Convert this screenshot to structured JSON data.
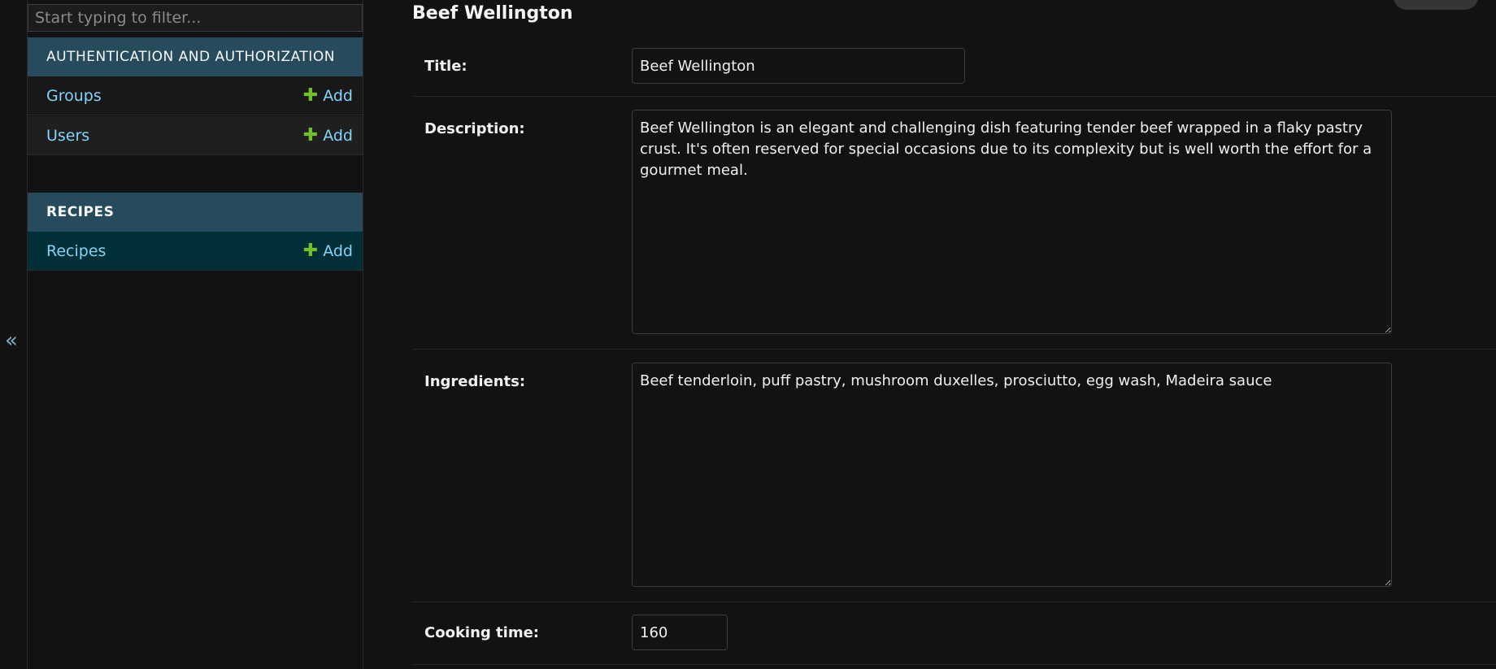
{
  "sidebar": {
    "toggle_label": "«",
    "filter_placeholder": "Start typing to filter...",
    "apps": [
      {
        "name": "AUTHENTICATION AND AUTHORIZATION",
        "models": [
          {
            "name": "Groups",
            "add_label": "Add"
          },
          {
            "name": "Users",
            "add_label": "Add"
          }
        ]
      },
      {
        "name": "RECIPES",
        "models": [
          {
            "name": "Recipes",
            "add_label": "Add"
          }
        ]
      }
    ]
  },
  "form": {
    "title": "Beef Wellington",
    "fields": {
      "title": {
        "label": "Title:",
        "value": "Beef Wellington"
      },
      "description": {
        "label": "Description:",
        "value": "Beef Wellington is an elegant and challenging dish featuring tender beef wrapped in a flaky pastry crust. It's often reserved for special occasions due to its complexity but is well worth the effort for a gourmet meal."
      },
      "ingredients": {
        "label": "Ingredients:",
        "value": "Beef tenderloin, puff pastry, mushroom duxelles, prosciutto, egg wash, Madeira sauce"
      },
      "cooking_time": {
        "label": "Cooking time:",
        "value": "160"
      }
    }
  },
  "colors": {
    "background": "#121212",
    "app_header": "#264b5d",
    "current_row": "#002f37",
    "link": "#81d4fa",
    "add_plus": "#70bf2b"
  }
}
